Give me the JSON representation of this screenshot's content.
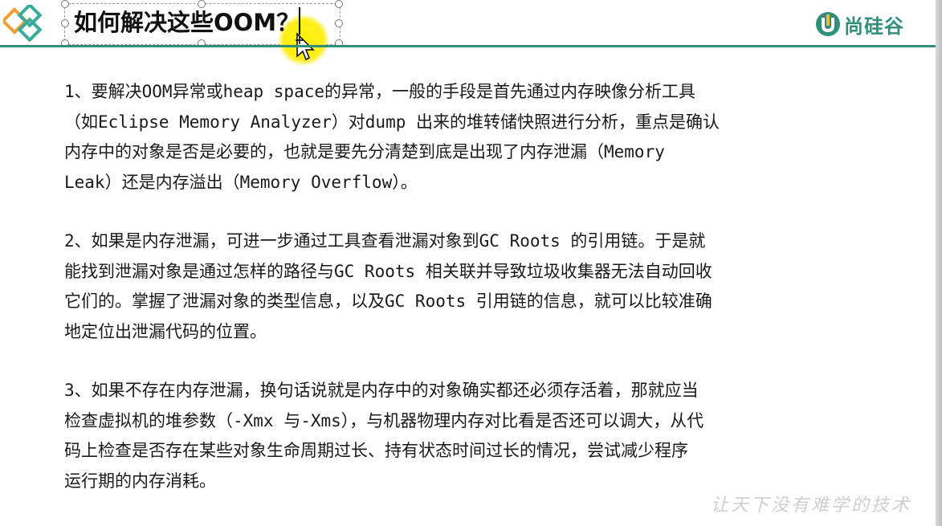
{
  "slide": {
    "title": "如何解决这些OOM？",
    "brand_name": "尚硅谷",
    "paragraphs": [
      "1、要解决OOM异常或heap space的异常，一般的手段是首先通过内存映像分析工具\n（如Eclipse Memory Analyzer）对dump 出来的堆转储快照进行分析，重点是确认\n内存中的对象是否是必要的，也就是要先分清楚到底是出现了内存泄漏（Memory\nLeak）还是内存溢出（Memory Overflow）。",
      "2、如果是内存泄漏，可进一步通过工具查看泄漏对象到GC Roots 的引用链。于是就\n能找到泄漏对象是通过怎样的路径与GC Roots 相关联并导致垃圾收集器无法自动回收\n它们的。掌握了泄漏对象的类型信息，以及GC Roots 引用链的信息，就可以比较准确\n地定位出泄漏代码的位置。",
      "3、如果不存在内存泄漏，换句话说就是内存中的对象确实都还必须存活着，那就应当\n检查虚拟机的堆参数（-Xmx 与-Xms），与机器物理内存对比看是否还可以调大，从代\n码上检查是否存在某些对象生命周期过长、持有状态时间过长的情况，尝试减少程序\n运行期的内存消耗。"
    ],
    "motto": "让天下没有难学的技术"
  },
  "colors": {
    "accent": "#2f8f7b",
    "diamond_orange": "#f0a030",
    "diamond_teal": "#3aaa9a",
    "cursor_highlight": "#ffec00"
  },
  "icons": {
    "logo": "diamond-logo-icon",
    "brand": "brand-u-icon",
    "cursor": "move-cursor-icon"
  }
}
